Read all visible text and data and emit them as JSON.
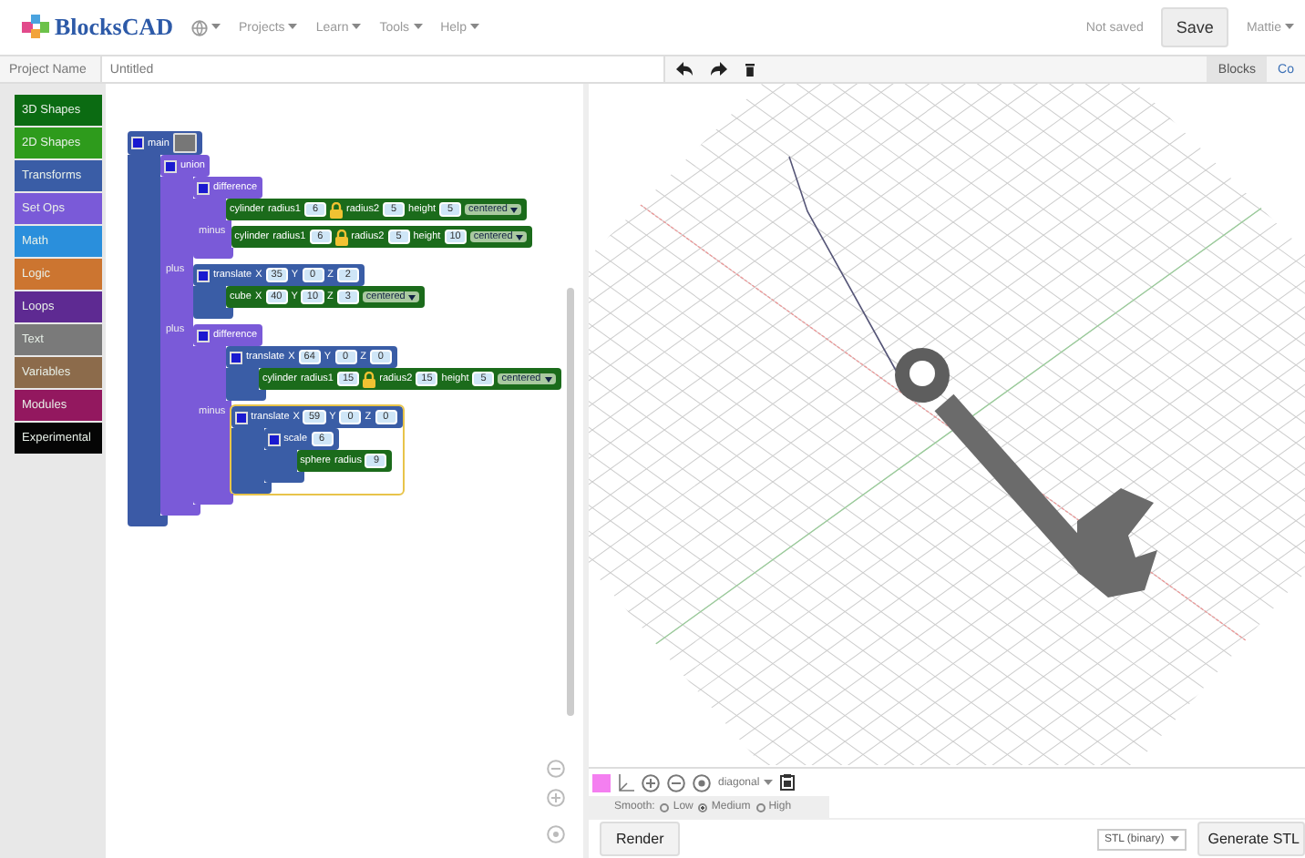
{
  "header": {
    "logo": "BlocksCAD",
    "menus": [
      {
        "label": "Projects"
      },
      {
        "label": "Learn"
      },
      {
        "label": "Tools"
      },
      {
        "label": "Help"
      }
    ],
    "save_status": "Not saved",
    "save_button": "Save",
    "user_menu": "Mattie"
  },
  "project_bar": {
    "label": "Project Name",
    "value": "Untitled",
    "tabs": [
      {
        "label": "Blocks",
        "selected": true
      },
      {
        "label": "Co",
        "selected": false
      }
    ]
  },
  "palette": [
    {
      "label": "3D Shapes",
      "color": "#0b6b12"
    },
    {
      "label": "2D Shapes",
      "color": "#2e9b1c"
    },
    {
      "label": "Transforms",
      "color": "#3a5da6"
    },
    {
      "label": "Set Ops",
      "color": "#7a5ad8"
    },
    {
      "label": "Math",
      "color": "#2a8fdc"
    },
    {
      "label": "Logic",
      "color": "#cc7530"
    },
    {
      "label": "Loops",
      "color": "#5e2a92"
    },
    {
      "label": "Text",
      "color": "#7a7a7a"
    },
    {
      "label": "Variables",
      "color": "#8c6b4b"
    },
    {
      "label": "Modules",
      "color": "#93185f"
    },
    {
      "label": "Experimental",
      "color": "#050505"
    }
  ],
  "blocks": [
    {
      "kind": "main",
      "selected": false,
      "parts": [
        {
          "kind": "label",
          "text": "main"
        },
        {
          "kind": "color"
        }
      ],
      "inputs": [
        {
          "blocks": [
            {
              "kind": "setop",
              "selected": false,
              "parts": [
                {
                  "kind": "label",
                  "text": "union"
                }
              ],
              "inputs": [
                {
                  "blocks": [
                    {
                      "kind": "setop",
                      "selected": false,
                      "parts": [
                        {
                          "kind": "label",
                          "text": "difference"
                        }
                      ],
                      "inputs": [
                        {
                          "blocks": [
                            {
                              "kind": "shape",
                              "selected": false,
                              "parts": [
                                {
                                  "kind": "label",
                                  "text": "cylinder"
                                },
                                {
                                  "kind": "label",
                                  "text": "radius1"
                                },
                                {
                                  "kind": "num",
                                  "text": "6"
                                },
                                {
                                  "kind": "lock"
                                },
                                {
                                  "kind": "label",
                                  "text": "radius2"
                                },
                                {
                                  "kind": "num",
                                  "text": "5"
                                },
                                {
                                  "kind": "label",
                                  "text": "height"
                                },
                                {
                                  "kind": "num",
                                  "text": "5"
                                },
                                {
                                  "kind": "drop",
                                  "text": "centered"
                                }
                              ]
                            }
                          ]
                        },
                        {
                          "label": "minus",
                          "blocks": [
                            {
                              "kind": "shape",
                              "selected": false,
                              "parts": [
                                {
                                  "kind": "label",
                                  "text": "cylinder"
                                },
                                {
                                  "kind": "label",
                                  "text": "radius1"
                                },
                                {
                                  "kind": "num",
                                  "text": "6"
                                },
                                {
                                  "kind": "lock"
                                },
                                {
                                  "kind": "label",
                                  "text": "radius2"
                                },
                                {
                                  "kind": "num",
                                  "text": "5"
                                },
                                {
                                  "kind": "label",
                                  "text": "height"
                                },
                                {
                                  "kind": "num",
                                  "text": "10"
                                },
                                {
                                  "kind": "drop",
                                  "text": "centered"
                                }
                              ]
                            }
                          ]
                        }
                      ]
                    }
                  ]
                },
                {
                  "label": "plus",
                  "blocks": [
                    {
                      "kind": "transform",
                      "selected": false,
                      "parts": [
                        {
                          "kind": "label",
                          "text": "translate"
                        },
                        {
                          "kind": "label",
                          "text": "X"
                        },
                        {
                          "kind": "num",
                          "text": "35"
                        },
                        {
                          "kind": "label",
                          "text": "Y"
                        },
                        {
                          "kind": "num",
                          "text": "0"
                        },
                        {
                          "kind": "label",
                          "text": "Z"
                        },
                        {
                          "kind": "num",
                          "text": "2"
                        }
                      ],
                      "inputs": [
                        {
                          "blocks": [
                            {
                              "kind": "shape",
                              "selected": false,
                              "parts": [
                                {
                                  "kind": "label",
                                  "text": "cube"
                                },
                                {
                                  "kind": "label",
                                  "text": "X"
                                },
                                {
                                  "kind": "num",
                                  "text": "40"
                                },
                                {
                                  "kind": "label",
                                  "text": "Y"
                                },
                                {
                                  "kind": "num",
                                  "text": "10"
                                },
                                {
                                  "kind": "label",
                                  "text": "Z"
                                },
                                {
                                  "kind": "num",
                                  "text": "3"
                                },
                                {
                                  "kind": "drop",
                                  "text": "centered"
                                }
                              ]
                            }
                          ]
                        }
                      ]
                    }
                  ]
                },
                {
                  "label": "plus",
                  "blocks": [
                    {
                      "kind": "setop",
                      "selected": false,
                      "parts": [
                        {
                          "kind": "label",
                          "text": "difference"
                        }
                      ],
                      "inputs": [
                        {
                          "blocks": [
                            {
                              "kind": "transform",
                              "selected": false,
                              "parts": [
                                {
                                  "kind": "label",
                                  "text": "translate"
                                },
                                {
                                  "kind": "label",
                                  "text": "X"
                                },
                                {
                                  "kind": "num",
                                  "text": "64"
                                },
                                {
                                  "kind": "label",
                                  "text": "Y"
                                },
                                {
                                  "kind": "num",
                                  "text": "0"
                                },
                                {
                                  "kind": "label",
                                  "text": "Z"
                                },
                                {
                                  "kind": "num",
                                  "text": "0"
                                }
                              ],
                              "inputs": [
                                {
                                  "blocks": [
                                    {
                                      "kind": "shape",
                                      "selected": false,
                                      "parts": [
                                        {
                                          "kind": "label",
                                          "text": "cylinder"
                                        },
                                        {
                                          "kind": "label",
                                          "text": "radius1"
                                        },
                                        {
                                          "kind": "num",
                                          "text": "15"
                                        },
                                        {
                                          "kind": "lock"
                                        },
                                        {
                                          "kind": "label",
                                          "text": "radius2"
                                        },
                                        {
                                          "kind": "num",
                                          "text": "15"
                                        },
                                        {
                                          "kind": "label",
                                          "text": "height"
                                        },
                                        {
                                          "kind": "num",
                                          "text": "5"
                                        },
                                        {
                                          "kind": "drop",
                                          "text": "centered"
                                        }
                                      ]
                                    }
                                  ]
                                }
                              ]
                            }
                          ]
                        },
                        {
                          "label": "minus",
                          "blocks": [
                            {
                              "kind": "transform",
                              "selected": true,
                              "parts": [
                                {
                                  "kind": "label",
                                  "text": "translate"
                                },
                                {
                                  "kind": "label",
                                  "text": "X"
                                },
                                {
                                  "kind": "num",
                                  "text": "59"
                                },
                                {
                                  "kind": "label",
                                  "text": "Y"
                                },
                                {
                                  "kind": "num",
                                  "text": "0"
                                },
                                {
                                  "kind": "label",
                                  "text": "Z"
                                },
                                {
                                  "kind": "num",
                                  "text": "0"
                                }
                              ],
                              "inputs": [
                                {
                                  "blocks": [
                                    {
                                      "kind": "transform",
                                      "selected": false,
                                      "parts": [
                                        {
                                          "kind": "label",
                                          "text": "scale"
                                        },
                                        {
                                          "kind": "num",
                                          "text": "6"
                                        }
                                      ],
                                      "inputs": [
                                        {
                                          "blocks": [
                                            {
                                              "kind": "shape",
                                              "selected": false,
                                              "parts": [
                                                {
                                                  "kind": "label",
                                                  "text": "sphere"
                                                },
                                                {
                                                  "kind": "label",
                                                  "text": "radius"
                                                },
                                                {
                                                  "kind": "num",
                                                  "text": "9"
                                                }
                                              ]
                                            }
                                          ]
                                        }
                                      ]
                                    }
                                  ]
                                }
                              ]
                            }
                          ]
                        }
                      ]
                    }
                  ]
                }
              ]
            }
          ]
        }
      ]
    }
  ],
  "viewer": {
    "camera": "diagonal",
    "smooth_label": "Smooth:",
    "smooth": [
      {
        "label": "Low",
        "selected": false
      },
      {
        "label": "Medium",
        "selected": true
      },
      {
        "label": "High",
        "selected": false
      }
    ],
    "render_button": "Render",
    "format": "STL (binary)",
    "generate_button": "Generate STL"
  }
}
